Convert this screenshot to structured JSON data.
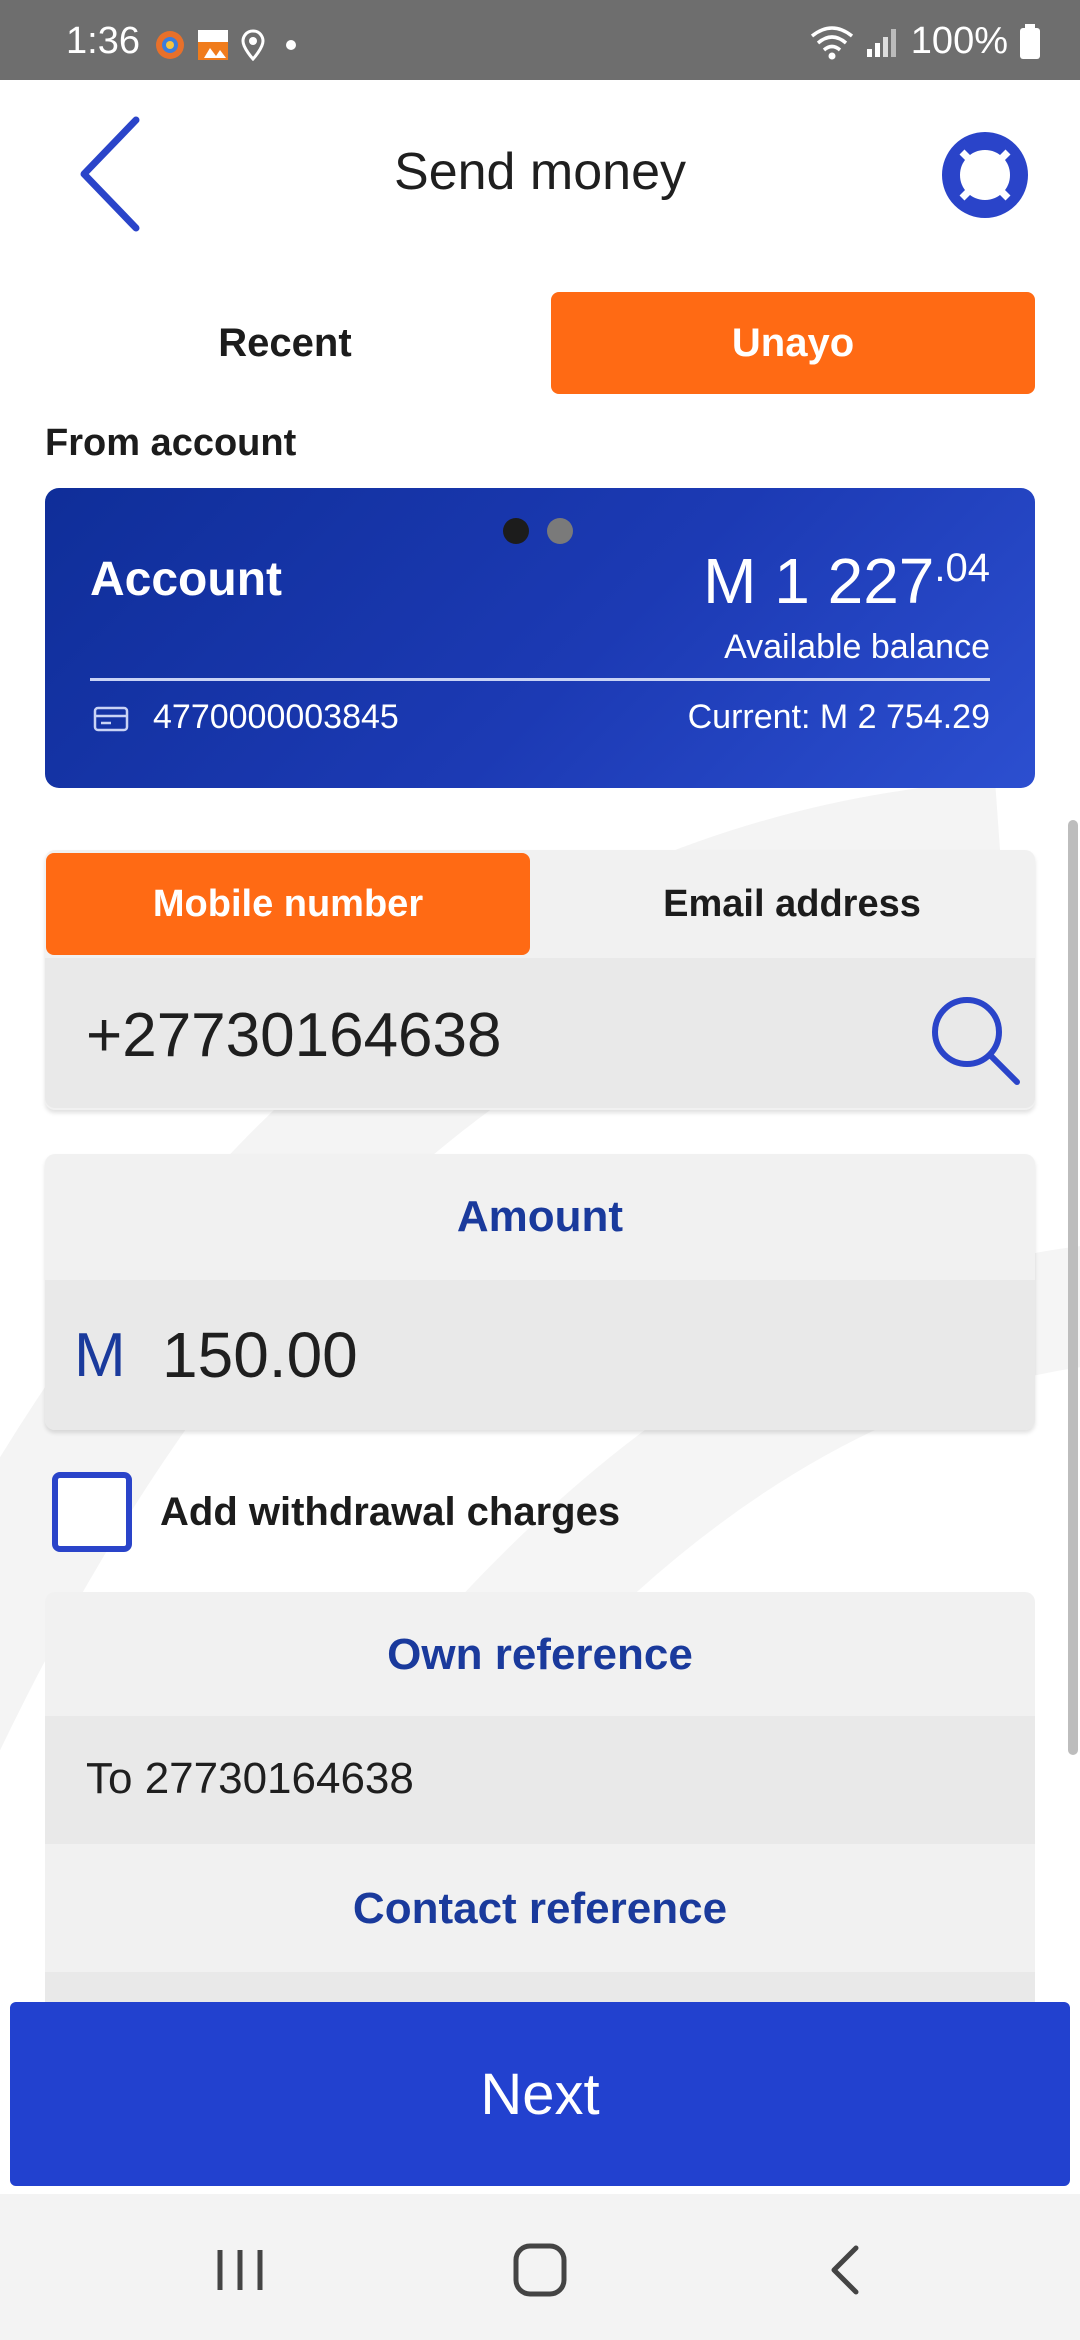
{
  "status_bar": {
    "time": "1:36",
    "battery": "100%"
  },
  "header": {
    "title": "Send money"
  },
  "tabs": [
    {
      "label": "Recent",
      "active": false
    },
    {
      "label": "Unayo",
      "active": true
    }
  ],
  "from_account": {
    "label": "From account",
    "card": {
      "name": "Account",
      "balance_main": "M 1 227",
      "balance_cents": ".04",
      "balance_label": "Available balance",
      "account_number": "4770000003845",
      "current": "Current: M 2 754.29",
      "page_count": 2,
      "active_page": 1
    }
  },
  "contact_method": {
    "tabs": [
      {
        "label": "Mobile number",
        "active": true
      },
      {
        "label": "Email address",
        "active": false
      }
    ],
    "value": "+27730164638"
  },
  "amount": {
    "label": "Amount",
    "currency": "M",
    "value": "150.00"
  },
  "withdrawal_charges": {
    "label": "Add withdrawal charges",
    "checked": false
  },
  "own_reference": {
    "label": "Own reference",
    "value": "To 27730164638"
  },
  "contact_reference": {
    "label": "Contact reference",
    "value": ""
  },
  "next_button": {
    "label": "Next"
  },
  "colors": {
    "accent_orange": "#ff6a14",
    "primary_blue": "#2241cf",
    "label_blue": "#1a3a9c",
    "card_blue": "#1c3ab4"
  }
}
